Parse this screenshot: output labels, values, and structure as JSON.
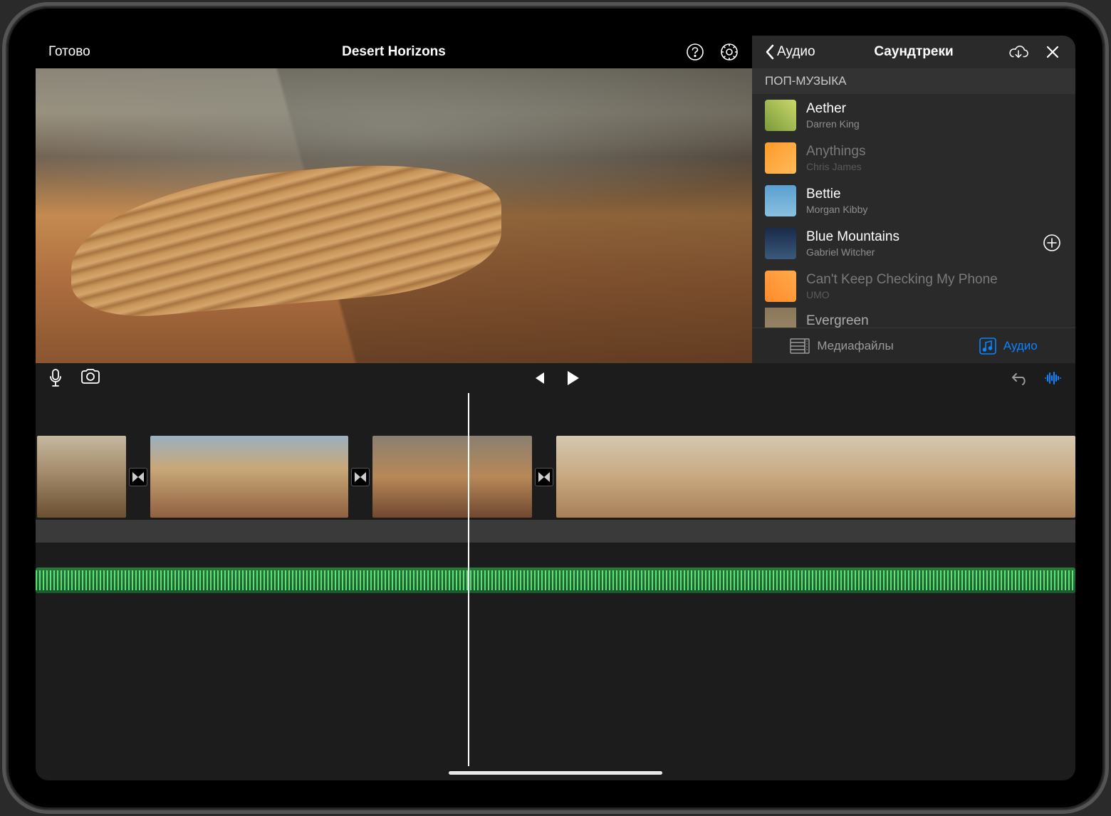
{
  "header": {
    "done": "Готово",
    "title": "Desert Horizons"
  },
  "sidePanel": {
    "back": "Аудио",
    "title": "Саундтреки",
    "category": "ПОП-МУЗЫКА",
    "tracks": [
      {
        "title": "Aether",
        "artist": "Darren King",
        "available": true
      },
      {
        "title": "Anythings",
        "artist": "Chris James",
        "available": false
      },
      {
        "title": "Bettie",
        "artist": "Morgan Kibby",
        "available": true
      },
      {
        "title": "Blue Mountains",
        "artist": "Gabriel Witcher",
        "available": true,
        "addable": true
      },
      {
        "title": "Can't Keep Checking My Phone",
        "artist": "UMO",
        "available": false
      },
      {
        "title": "Evergreen",
        "artist": "",
        "available": true
      }
    ],
    "tabs": {
      "media": "Медиафайлы",
      "audio": "Аудио"
    }
  }
}
